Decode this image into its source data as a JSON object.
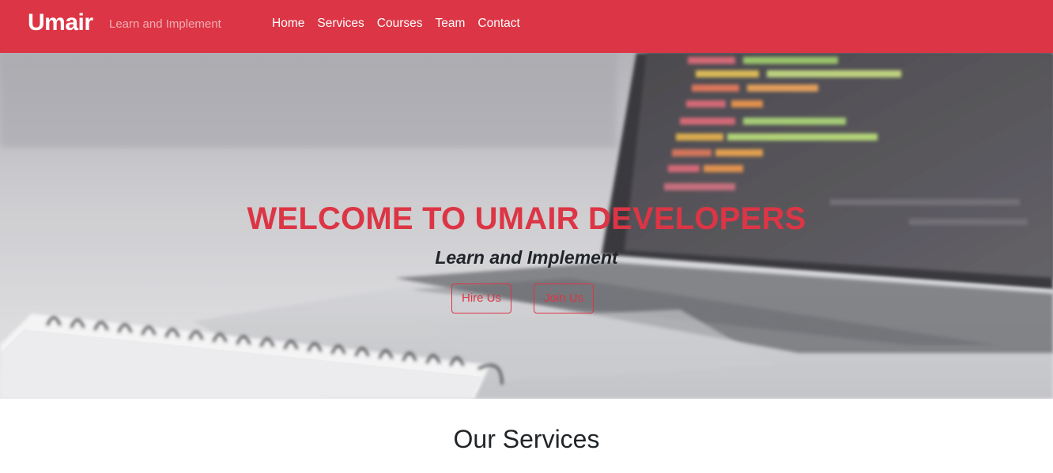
{
  "navbar": {
    "brand": "Umair",
    "tagline": "Learn and Implement",
    "links": [
      "Home",
      "Services",
      "Courses",
      "Team",
      "Contact"
    ],
    "background_color": "#dc3545"
  },
  "hero": {
    "title": "WELCOME TO UMAIR DEVELOPERS",
    "subtitle": "Learn and Implement",
    "buttons": [
      "Hire Us",
      "Join Us"
    ],
    "accent_color": "#dc3545",
    "background_image": "laptop-and-notebook-photo"
  },
  "services": {
    "heading": "Our Services"
  }
}
